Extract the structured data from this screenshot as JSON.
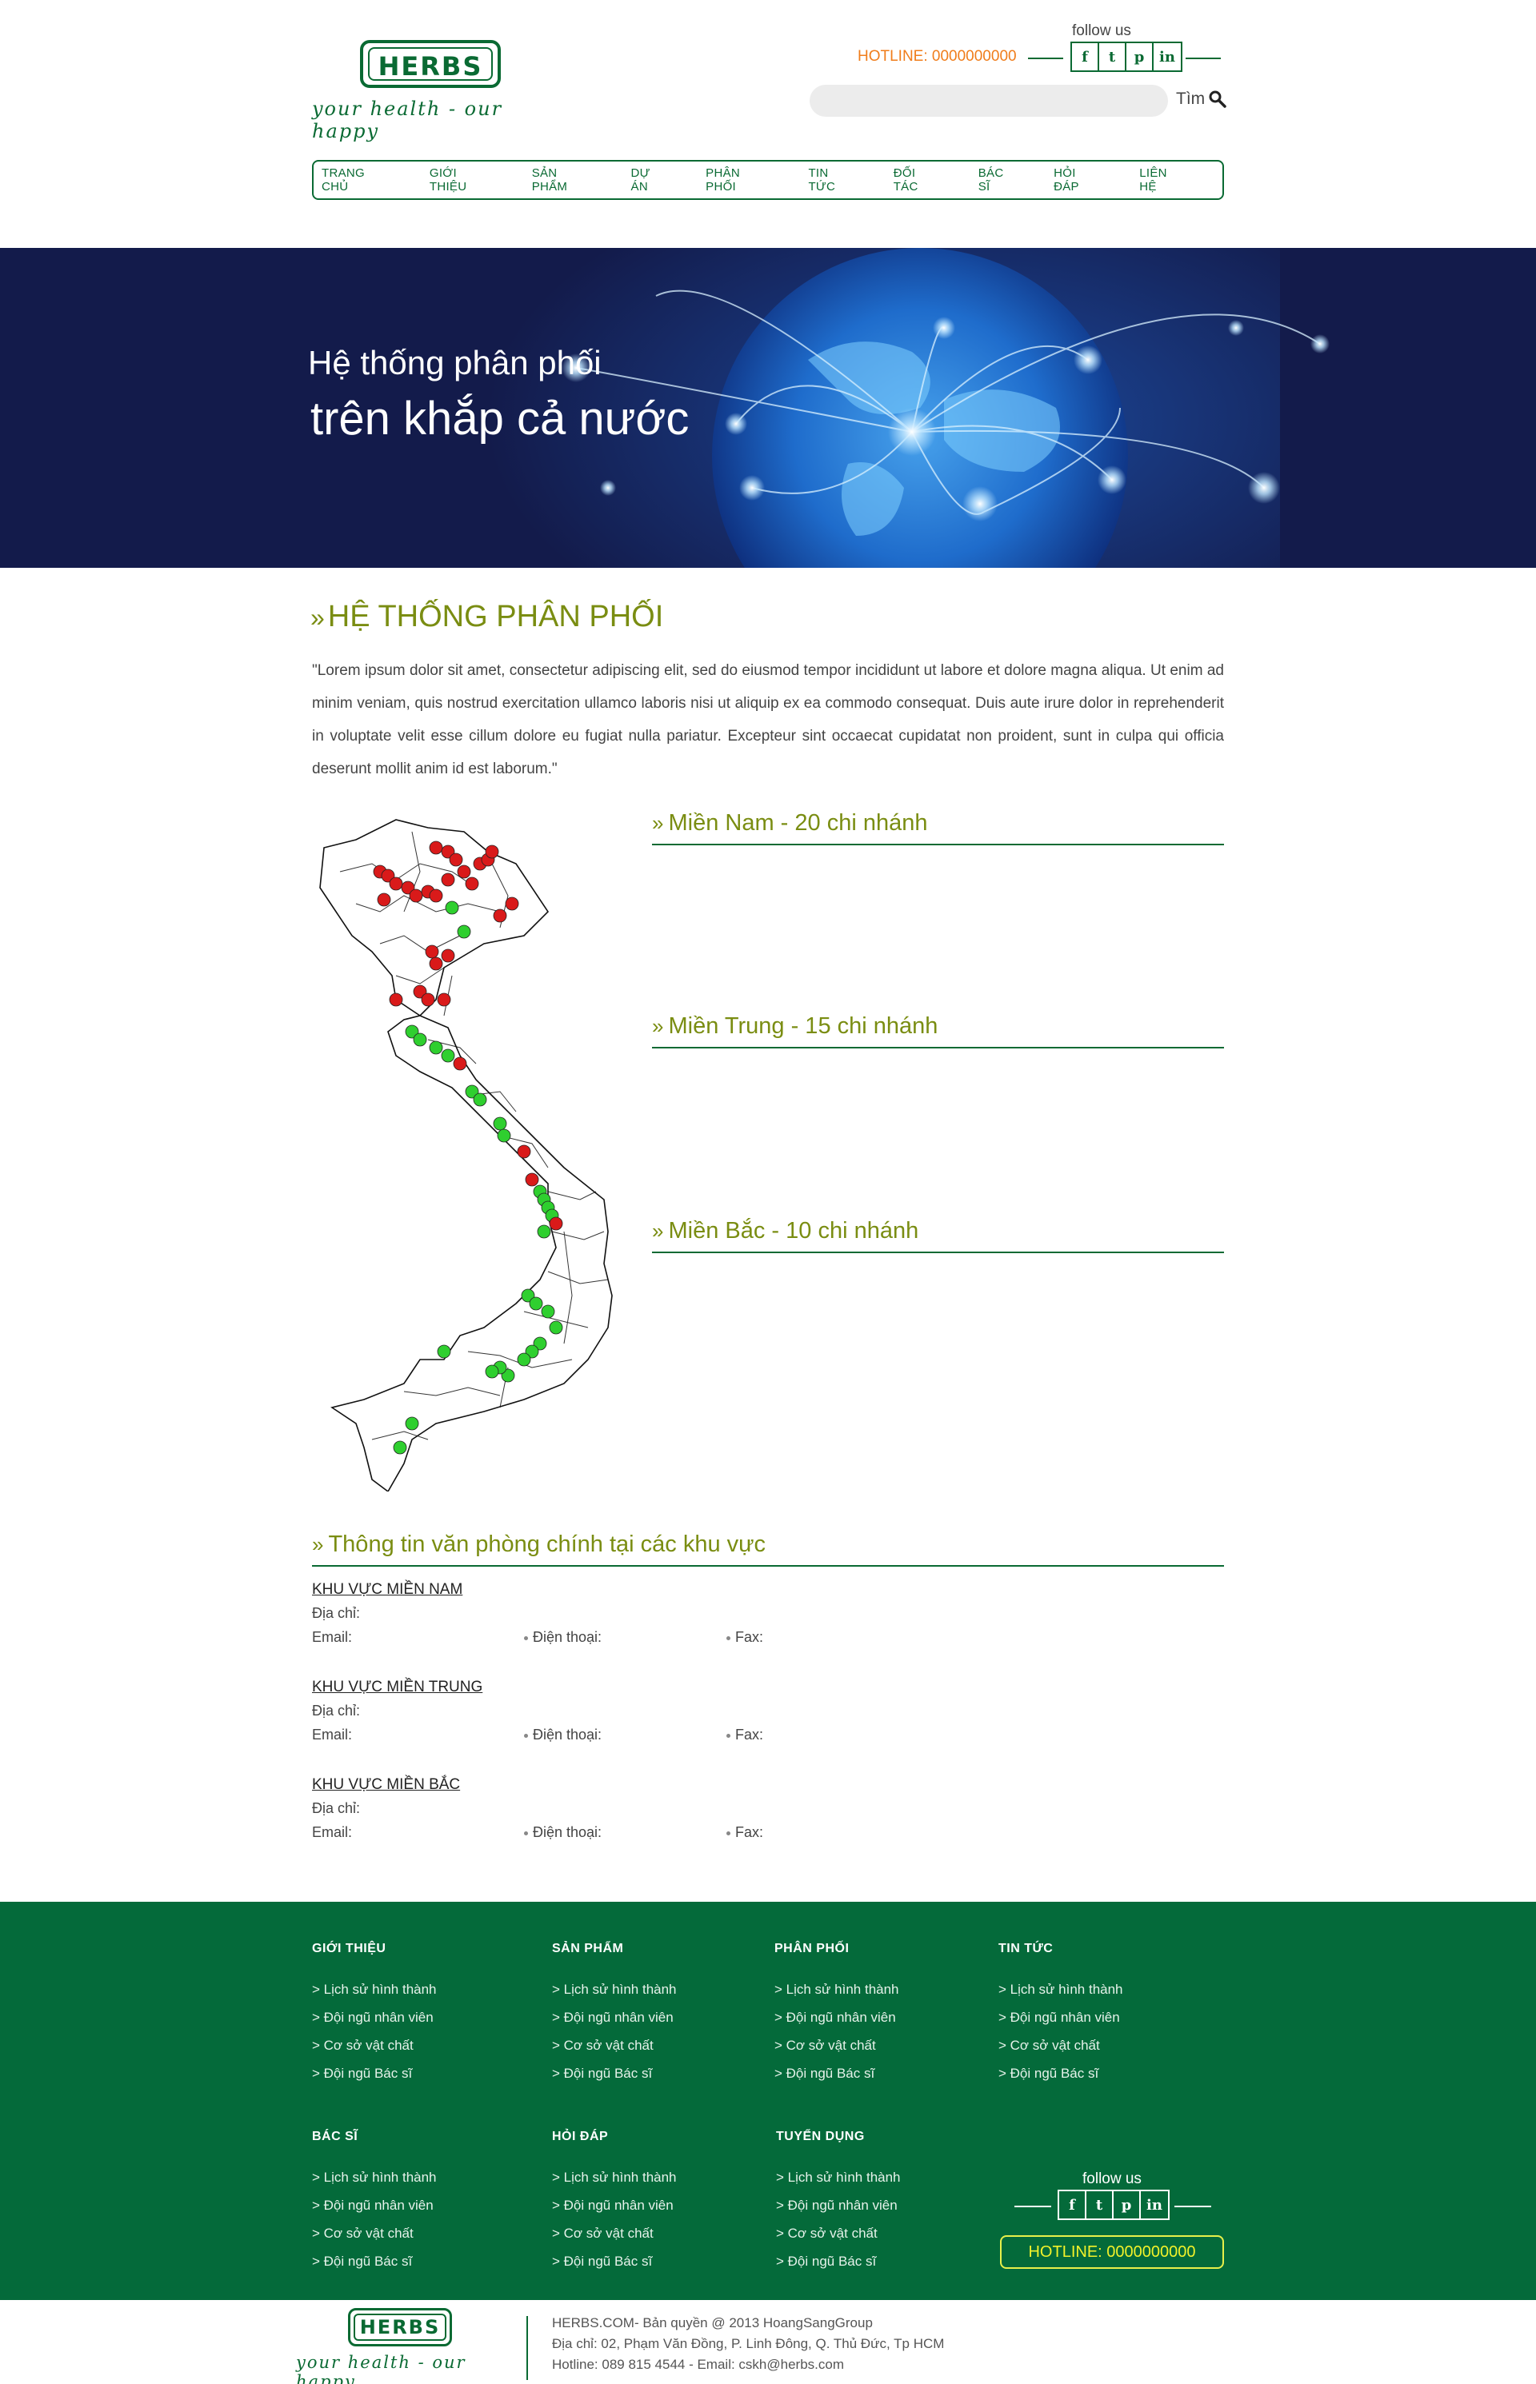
{
  "header": {
    "logo_text": "HERBS",
    "logo_tagline": "your health - our happy",
    "hotline": "HOTLINE: 0000000000",
    "follow_label": "follow us",
    "social_icons": [
      "f",
      "t",
      "p",
      "in"
    ],
    "search_button": "Tìm",
    "search_placeholder": ""
  },
  "nav": [
    "TRANG CHỦ",
    "GIỚI THIỆU",
    "SẢN PHẨM",
    "DỰ ÁN",
    "PHÂN PHỐI",
    "TIN TỨC",
    "ĐỐI TÁC",
    "BÁC SĨ",
    "HỎI ĐÁP",
    "LIÊN HỆ"
  ],
  "banner": {
    "line1": "Hệ thống phân phối",
    "line2": "trên khắp cả nước"
  },
  "main": {
    "title": "HỆ THỐNG PHÂN PHỐI",
    "intro": "\"Lorem ipsum dolor sit amet, consectetur adipiscing elit, sed do eiusmod tempor incididunt ut labore et dolore magna aliqua. Ut enim ad minim veniam, quis nostrud exercitation ullamco laboris nisi ut aliquip ex ea commodo consequat. Duis aute irure dolor in reprehenderit in voluptate velit esse cillum dolore eu fugiat nulla pariatur. Excepteur sint occaecat cupidatat non proident, sunt in culpa qui officia deserunt mollit anim id est laborum.\"",
    "regions": [
      "Miền Nam - 20 chi nhánh",
      "Miền Trung - 15 chi nhánh",
      "Miền Bắc - 10 chi nhánh"
    ],
    "marker_colors": {
      "red": "#d91a1a",
      "green": "#2fcf2f"
    }
  },
  "offices": {
    "title": "Thông tin văn phòng chính tại các khu vực",
    "items": [
      {
        "name": "KHU VỰC MIỀN NAM",
        "address_label": "Địa chỉ:",
        "email_label": "Email:",
        "phone_label": "Điện thoại:",
        "fax_label": "Fax:"
      },
      {
        "name": "KHU VỰC MIỀN TRUNG",
        "address_label": "Địa chỉ:",
        "email_label": "Email:",
        "phone_label": "Điện thoại:",
        "fax_label": "Fax:"
      },
      {
        "name": "KHU VỰC MIỀN BẮC",
        "address_label": "Địa chỉ:",
        "email_label": "Email:",
        "phone_label": "Điện thoại:",
        "fax_label": "Fax:"
      }
    ]
  },
  "footer": {
    "columns": [
      {
        "heading": "GIỚI THIỆU",
        "links": [
          "> Lịch sử hình thành",
          "> Đội ngũ nhân viên",
          "> Cơ sở vật chất",
          "> Đội ngũ Bác sĩ"
        ]
      },
      {
        "heading": "SẢN PHẨM",
        "links": [
          "> Lịch sử hình thành",
          "> Đội ngũ nhân viên",
          "> Cơ sở vật chất",
          "> Đội ngũ Bác sĩ"
        ]
      },
      {
        "heading": "PHÂN PHỐI",
        "links": [
          "> Lịch sử hình thành",
          "> Đội ngũ nhân viên",
          "> Cơ sở vật chất",
          "> Đội ngũ Bác sĩ"
        ]
      },
      {
        "heading": "TIN TỨC",
        "links": [
          "> Lịch sử hình thành",
          "> Đội ngũ nhân viên",
          "> Cơ sở vật chất",
          "> Đội ngũ Bác sĩ"
        ]
      },
      {
        "heading": "BÁC SĨ",
        "links": [
          "> Lịch sử hình thành",
          "> Đội ngũ nhân viên",
          "> Cơ sở vật chất",
          "> Đội ngũ Bác sĩ"
        ]
      },
      {
        "heading": "HỎI ĐÁP",
        "links": [
          "> Lịch sử hình thành",
          "> Đội ngũ nhân viên",
          "> Cơ sở vật chất",
          "> Đội ngũ Bác sĩ"
        ]
      },
      {
        "heading": "TUYỂN DỤNG",
        "links": [
          "> Lịch sử hình thành",
          "> Đội ngũ nhân viên",
          "> Cơ sở vật chất",
          "> Đội ngũ Bác sĩ"
        ]
      }
    ],
    "follow_label": "follow us",
    "hotline": "HOTLINE: 0000000000"
  },
  "bottom": {
    "logo_text": "HERBS",
    "logo_tagline": "your health - our happy",
    "copyright": "HERBS.COM- Bản quyền @ 2013 HoangSangGroup",
    "address": "Địa chỉ: 02, Phạm Văn Đồng, P. Linh Đông, Q. Thủ Đức, Tp HCM",
    "contact": "Hotline: 089 815 4544 - Email: cskh@herbs.com"
  },
  "colors": {
    "brand_green": "#0a6a33",
    "accent_olive": "#7a8d12",
    "hotline_orange": "#f07d1b",
    "footer_green": "#046a3a",
    "banner_navy": "#131b4b"
  }
}
